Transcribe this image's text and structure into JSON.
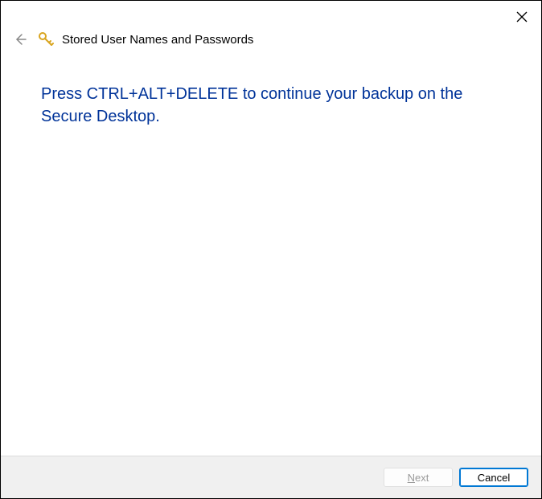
{
  "header": {
    "title": "Stored User Names and Passwords"
  },
  "content": {
    "instruction": "Press CTRL+ALT+DELETE to continue your backup on the Secure Desktop."
  },
  "footer": {
    "next_mnemonic": "N",
    "next_rest": "ext",
    "cancel_label": "Cancel"
  }
}
